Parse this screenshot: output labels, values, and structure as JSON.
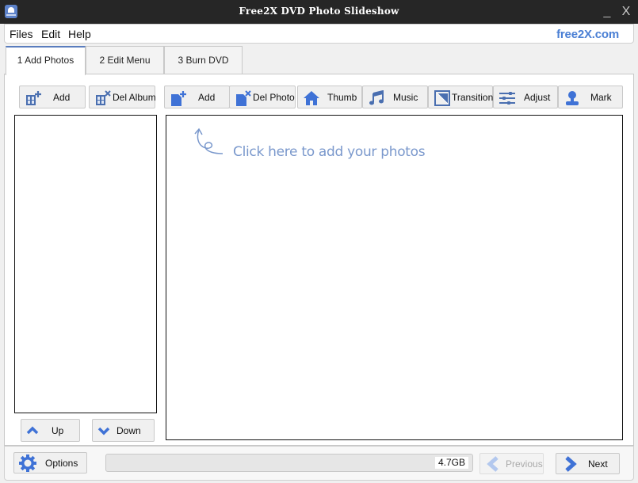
{
  "window": {
    "title": "Free2X DVD Photo Slideshow",
    "minimize_label": "_",
    "close_label": "X"
  },
  "menu": {
    "items": [
      "Files",
      "Edit",
      "Help"
    ],
    "brand": "free2X.com"
  },
  "tabs": [
    {
      "label": "1 Add Photos",
      "active": true
    },
    {
      "label": "2 Edit Menu",
      "active": false
    },
    {
      "label": "3 Burn DVD",
      "active": false
    }
  ],
  "album_toolbar": {
    "add": {
      "label": "Add",
      "icon": "add-album-icon"
    },
    "del_album": {
      "label": "Del Album",
      "icon": "delete-album-icon"
    }
  },
  "photo_toolbar": {
    "add": {
      "label": "Add",
      "icon": "add-photo-icon"
    },
    "del_photo": {
      "label": "Del Photo",
      "icon": "delete-photo-icon"
    },
    "thumb": {
      "label": "Thumb",
      "icon": "home-icon"
    },
    "music": {
      "label": "Music",
      "icon": "music-note-icon"
    },
    "transition": {
      "label": "Transition",
      "icon": "transition-icon"
    },
    "adjust": {
      "label": "Adjust",
      "icon": "sliders-icon"
    },
    "mark": {
      "label": "Mark",
      "icon": "stamp-icon"
    }
  },
  "photo_area": {
    "hint": "Click here to add your photos"
  },
  "album_nav": {
    "up": {
      "label": "Up",
      "icon": "chevron-up-icon"
    },
    "down": {
      "label": "Down",
      "icon": "chevron-down-icon"
    }
  },
  "footer": {
    "options": {
      "label": "Options",
      "icon": "gear-icon"
    },
    "capacity": "4.7GB",
    "previous": {
      "label": "Previous",
      "icon": "chevron-left-icon",
      "enabled": false
    },
    "next": {
      "label": "Next",
      "icon": "chevron-right-icon",
      "enabled": true
    }
  },
  "colors": {
    "accent": "#3f72d6",
    "titlebar": "#262626",
    "brand": "#4a7fd4",
    "hint": "#7a98cc"
  }
}
